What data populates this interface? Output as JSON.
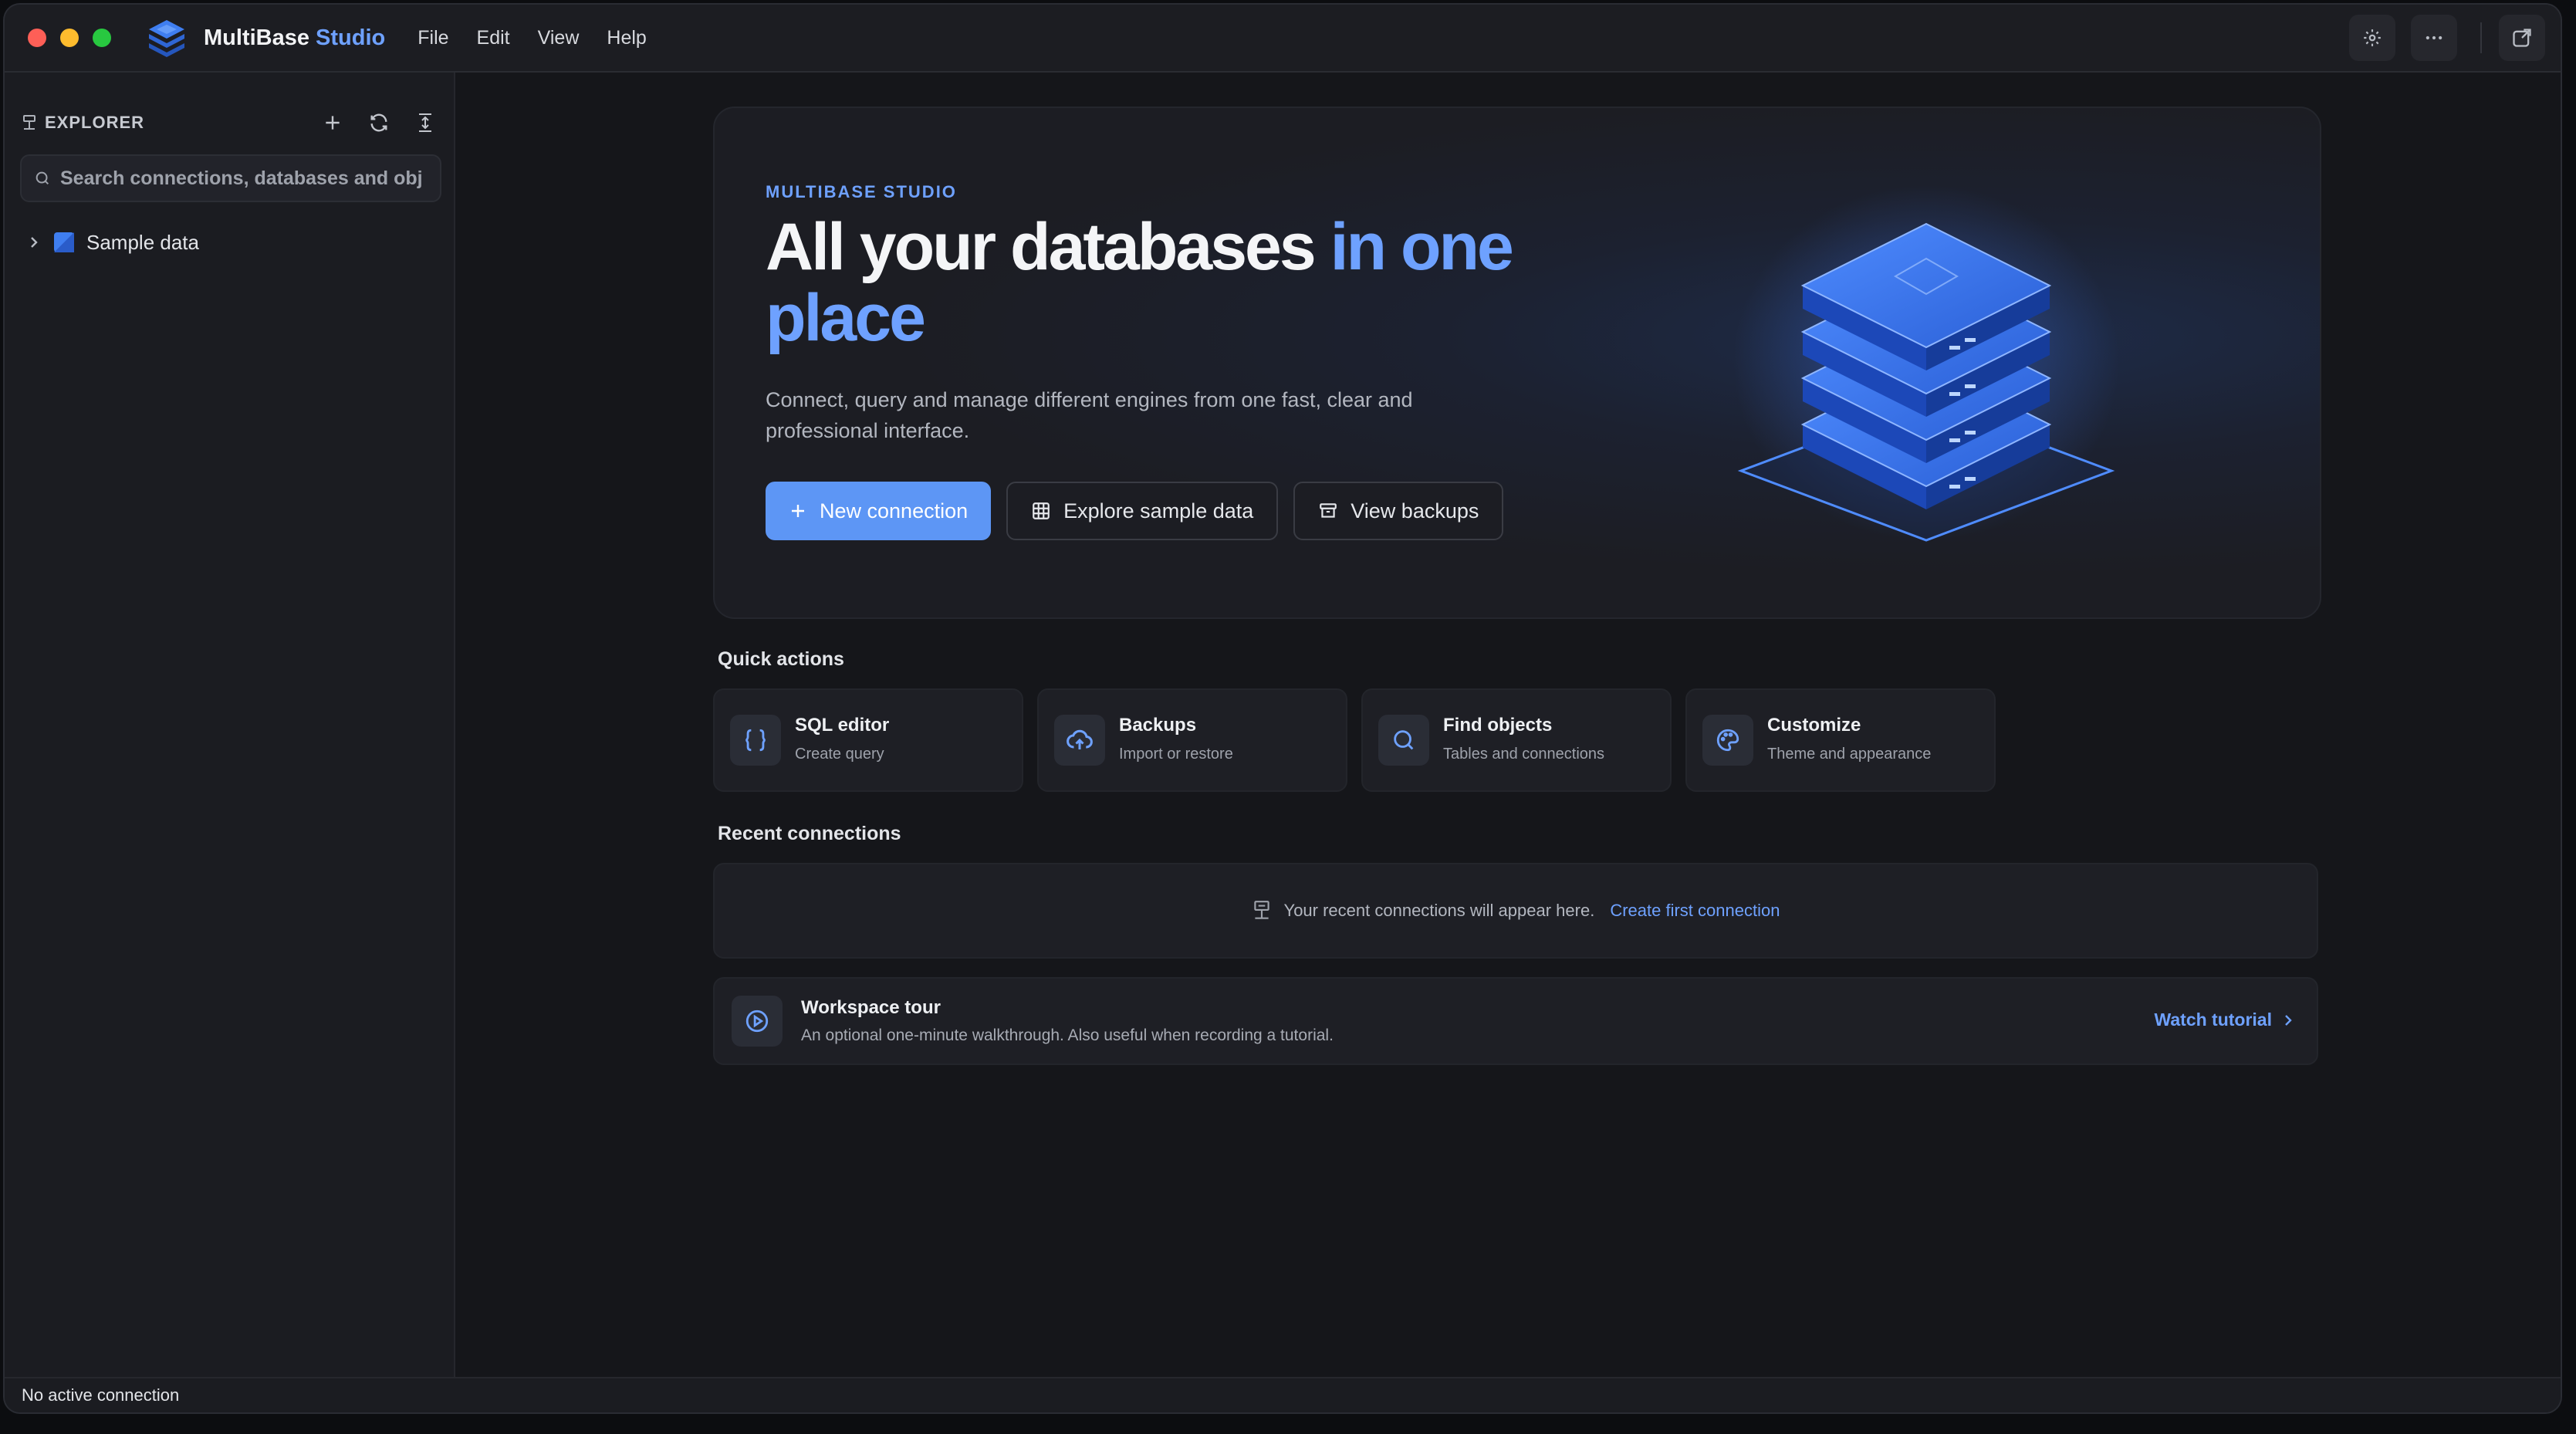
{
  "app": {
    "name": "MultiBase",
    "name_accent": "Studio"
  },
  "menu": {
    "file": "File",
    "edit": "Edit",
    "view": "View",
    "help": "Help"
  },
  "sidebar": {
    "title": "EXPLORER",
    "search_placeholder": "Search connections, databases and objects",
    "tree": [
      {
        "label": "Sample data"
      }
    ]
  },
  "hero": {
    "eyebrow": "MULTIBASE STUDIO",
    "title_plain": "All your databases ",
    "title_accent": "in one place",
    "description": "Connect, query and manage different engines from one fast, clear and professional interface.",
    "buttons": {
      "new_connection": "New connection",
      "explore_sample": "Explore sample data",
      "view_backups": "View backups"
    }
  },
  "quick_actions": {
    "title": "Quick actions",
    "items": [
      {
        "title": "SQL editor",
        "subtitle": "Create query",
        "icon": "braces-icon"
      },
      {
        "title": "Backups",
        "subtitle": "Import or restore",
        "icon": "cloud-upload-icon"
      },
      {
        "title": "Find objects",
        "subtitle": "Tables and connections",
        "icon": "search-icon"
      },
      {
        "title": "Customize",
        "subtitle": "Theme and appearance",
        "icon": "palette-icon"
      }
    ]
  },
  "recent": {
    "title": "Recent connections",
    "empty_message": "Your recent connections will appear here.",
    "create_link": "Create first connection"
  },
  "tour": {
    "title": "Workspace tour",
    "subtitle": "An optional one-minute walkthrough. Also useful when recording a tutorial.",
    "action": "Watch tutorial"
  },
  "status": {
    "text": "No active connection"
  },
  "colors": {
    "accent": "#6ea1ff",
    "primary_button": "#5d96f5",
    "background": "#15161a"
  }
}
